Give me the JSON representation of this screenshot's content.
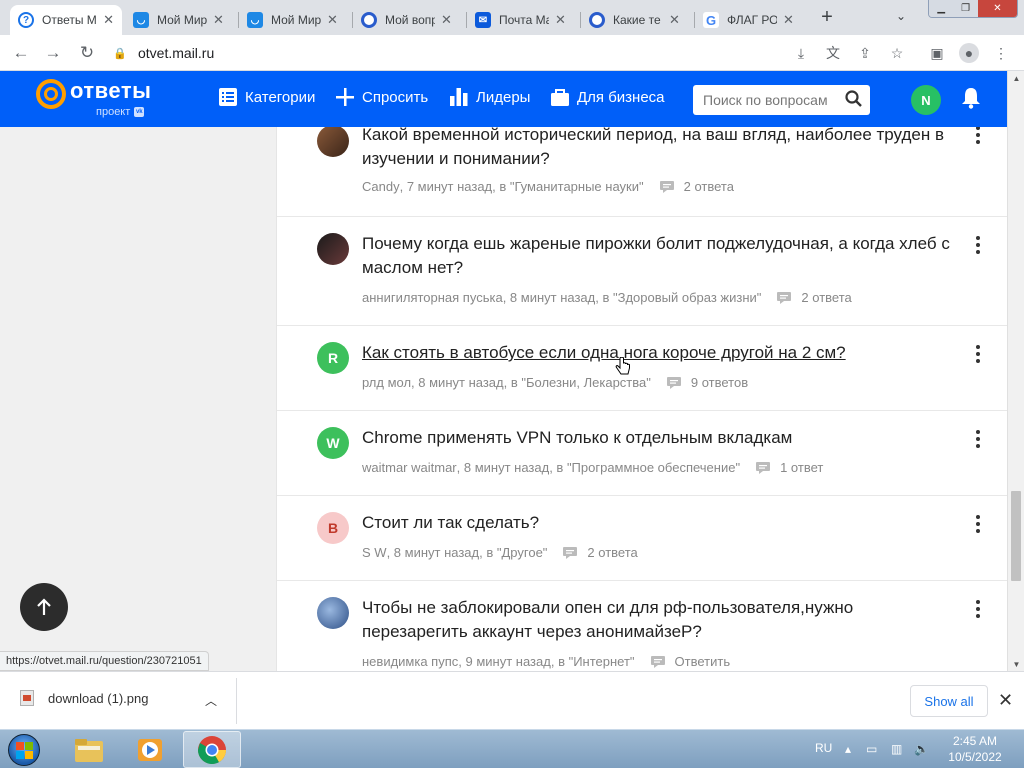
{
  "browser": {
    "tabs": [
      {
        "title": "Ответы Mail",
        "favicon": "question-icon",
        "color": "#1a73e8",
        "active": true
      },
      {
        "title": "Мой Мир",
        "favicon": "mymir-icon",
        "color": "#1e88e5",
        "active": false
      },
      {
        "title": "Мой Мир",
        "favicon": "mymir-icon",
        "color": "#1e88e5",
        "active": false
      },
      {
        "title": "Мой вопрос",
        "favicon": "otvety-icon",
        "color": "#2a5ccc",
        "active": false
      },
      {
        "title": "Почта Mail",
        "favicon": "mail-icon",
        "color": "#0c5adb",
        "active": false
      },
      {
        "title": "Какие те",
        "favicon": "otvety-icon",
        "color": "#2a5ccc",
        "active": false
      },
      {
        "title": "ФЛАГ РОССИИ",
        "favicon": "google-icon",
        "color": "#ffffff",
        "active": false
      }
    ],
    "url": "otvet.mail.ru",
    "status_url": "https://otvet.mail.ru/question/230721051"
  },
  "site": {
    "logo_text": "@ответы",
    "logo_sub": "проект",
    "nav": {
      "categories": "Категории",
      "ask": "Спросить",
      "leaders": "Лидеры",
      "business": "Для бизнеса"
    },
    "search_placeholder": "Поиск по вопросам",
    "user_initial": "N",
    "colors": {
      "header": "#005ff9",
      "logo_accent": "#ff9e00"
    }
  },
  "questions": [
    {
      "title": "Какой временной исторический период, на ваш вгляд, наиболее труден в изучении и понимании?",
      "author": "Candy",
      "time": "7 минут назад",
      "category": "в \"Гуманитарные науки\"",
      "answers": "2 ответа",
      "avatar": {
        "type": "photo",
        "initial": "",
        "bg": "#6b4a3a",
        "fg": "#ffffff"
      }
    },
    {
      "title": "Почему когда ешь жареные пирожки болит поджелудочная, а когда хлеб с маслом нет?",
      "author": "аннигиляторная пуська",
      "time": "8 минут назад",
      "category": "в \"Здоровый образ жизни\"",
      "answers": "2 ответа",
      "avatar": {
        "type": "photo",
        "initial": "",
        "bg": "#3a2a2a",
        "fg": "#ffffff"
      }
    },
    {
      "title": "Как стоять в автобусе если одна нога короче другой на 2 см?",
      "author": "рлд мол",
      "time": "8 минут назад",
      "category": "в \"Болезни, Лекарства\"",
      "answers": "9 ответов",
      "avatar": {
        "type": "letter",
        "initial": "R",
        "bg": "#3dc05c",
        "fg": "#ffffff"
      },
      "hovered": true
    },
    {
      "title": "Chrome применять VPN только к отдельным вкладкам",
      "author": "waitmar waitmar",
      "time": "8 минут назад",
      "category": "в \"Программное обеспечение\"",
      "answers": "1 ответ",
      "avatar": {
        "type": "letter",
        "initial": "W",
        "bg": "#3dc05c",
        "fg": "#ffffff"
      }
    },
    {
      "title": "Стоит ли так сделать?",
      "author": "S W",
      "time": "8 минут назад",
      "category": "в \"Другое\"",
      "answers": "2 ответа",
      "avatar": {
        "type": "letter",
        "initial": "B",
        "bg": "#f7c9c9",
        "fg": "#c0392b"
      }
    },
    {
      "title": "Чтобы не заблокировали опен си для рф-пользователя,нужно перезарегить аккаунт через анонимайзеР?",
      "author": "невидимка пупс",
      "time": "9 минут назад",
      "category": "в \"Интернет\"",
      "answers": "Ответить",
      "avatar": {
        "type": "photo",
        "initial": "",
        "bg": "#4a6fa5",
        "fg": "#ffffff"
      }
    }
  ],
  "download": {
    "filename": "download (1).png",
    "show_all": "Show all"
  },
  "taskbar": {
    "lang": "RU",
    "time": "2:45 AM",
    "date": "10/5/2022"
  }
}
